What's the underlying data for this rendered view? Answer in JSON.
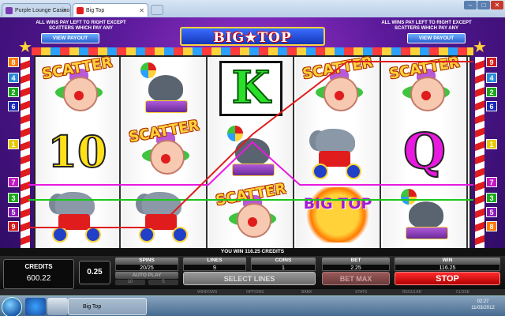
{
  "browser": {
    "tabs": [
      {
        "label": "Purple Lounge Casino",
        "color": "#7a3ab0"
      },
      {
        "label": "Big Top",
        "color": "#e01c1c"
      }
    ],
    "clock": "2:27"
  },
  "game": {
    "payinfo_left": "ALL WINS PAY LEFT TO RIGHT EXCEPT SCATTERS WHICH PAY ANY",
    "payinfo_right": "ALL WINS PAY LEFT TO RIGHT EXCEPT SCATTERS WHICH PAY ANY",
    "view_payout_label": "VIEW PAYOUT",
    "logo": "BIG★TOP",
    "reels": [
      [
        "scatter",
        "ten",
        "elephant"
      ],
      [
        "seal",
        "scatter",
        "elephant"
      ],
      [
        "K",
        "seal",
        "scatter"
      ],
      [
        "scatter",
        "elephant",
        "bigtop"
      ],
      [
        "scatter",
        "Q",
        "seal"
      ]
    ],
    "symbol_text": {
      "scatter": "SCATTER",
      "ten": "10",
      "K": "K",
      "Q": "Q",
      "bigtop": "BIG TOP"
    },
    "left_line_badges": [
      {
        "num": "8",
        "color": "#ff7a00"
      },
      {
        "num": "4",
        "color": "#2a8ad8"
      },
      {
        "num": "2",
        "color": "#1aa81a"
      },
      {
        "num": "6",
        "color": "#1a2ab8"
      },
      {
        "num": "1",
        "color": "#e8c800"
      },
      {
        "num": "7",
        "color": "#c01ac0"
      },
      {
        "num": "3",
        "color": "#1aa81a"
      },
      {
        "num": "5",
        "color": "#8a1ab8"
      },
      {
        "num": "9",
        "color": "#d01a1a"
      }
    ],
    "right_line_badges": [
      {
        "num": "9",
        "color": "#d01a1a"
      },
      {
        "num": "4",
        "color": "#2a8ad8"
      },
      {
        "num": "2",
        "color": "#1aa81a"
      },
      {
        "num": "6",
        "color": "#1a2ab8"
      },
      {
        "num": "1",
        "color": "#e8c800"
      },
      {
        "num": "7",
        "color": "#c01ac0"
      },
      {
        "num": "3",
        "color": "#1aa81a"
      },
      {
        "num": "5",
        "color": "#8a1ab8"
      },
      {
        "num": "8",
        "color": "#ff7a00"
      }
    ],
    "win_message": "YOU WIN 116.25 CREDITS"
  },
  "panel": {
    "credits_label": "CREDITS",
    "credits_value": "600.22",
    "coin_value": "0.25",
    "spins_label": "SPINS",
    "spins_value": "20/25",
    "autoplay_label": "AUTO PLAY",
    "autoplay_opt1": "10",
    "autoplay_opt2": "5",
    "lines_label": "LINES",
    "lines_value": "9",
    "coins_label": "COINS",
    "coins_value": "1",
    "bet_label": "BET",
    "bet_value": "2.25",
    "win_label": "WIN",
    "win_value": "116.25",
    "select_lines_label": "SELECT LINES",
    "bet_max_label": "BET MAX",
    "stop_label": "STOP"
  },
  "footer_labels": [
    "WINDOWS",
    "OPTIONS",
    "BANK",
    "STATS",
    "REGULAR",
    "CLOSE"
  ],
  "taskbar": {
    "task_label": "Big Top",
    "time": "02:27",
    "date": "11/03/2012"
  }
}
